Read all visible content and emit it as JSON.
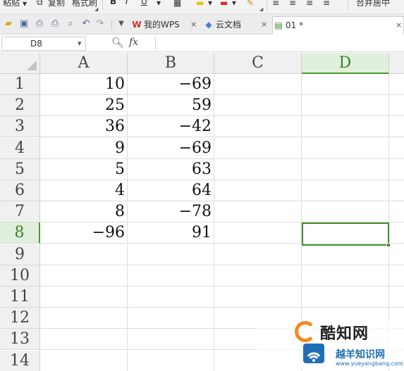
{
  "ribbon": {
    "paste_label": "粘贴",
    "copy_label": "复制",
    "format_painter_label": "格式刷",
    "merge_center_label": "合并居中",
    "bold_glyph": "B",
    "italic_glyph": "I",
    "underline_glyph": "U"
  },
  "tabs": {
    "wps_label": "我的WPS",
    "cloud_label": "云文档",
    "doc_label": "01 *",
    "close_glyph": "×"
  },
  "formula_bar": {
    "cell_ref": "D8",
    "fx_label": "fx",
    "value": ""
  },
  "sheet": {
    "columns": [
      "A",
      "B",
      "C",
      "D"
    ],
    "active_column": "D",
    "active_row": "8",
    "rows": [
      {
        "num": "1",
        "a": "10",
        "b": "−69"
      },
      {
        "num": "2",
        "a": "25",
        "b": "59"
      },
      {
        "num": "3",
        "a": "36",
        "b": "−42"
      },
      {
        "num": "4",
        "a": "9",
        "b": "−69"
      },
      {
        "num": "5",
        "a": "5",
        "b": "63"
      },
      {
        "num": "6",
        "a": "4",
        "b": "64"
      },
      {
        "num": "7",
        "a": "8",
        "b": "−78"
      },
      {
        "num": "8",
        "a": "−96",
        "b": "91"
      },
      {
        "num": "9",
        "a": "",
        "b": ""
      },
      {
        "num": "10",
        "a": "",
        "b": ""
      },
      {
        "num": "11",
        "a": "",
        "b": ""
      },
      {
        "num": "12",
        "a": "",
        "b": ""
      },
      {
        "num": "13",
        "a": "",
        "b": ""
      },
      {
        "num": "14",
        "a": "",
        "b": ""
      }
    ]
  },
  "watermark": {
    "brand1": "酷知网",
    "brand2": "越羊知识网",
    "url": "www.yueyangbang.com"
  },
  "colors": {
    "accent_green": "#3f8a2a",
    "header_bg": "#f0f0f0",
    "wps_red": "#d0312d"
  }
}
